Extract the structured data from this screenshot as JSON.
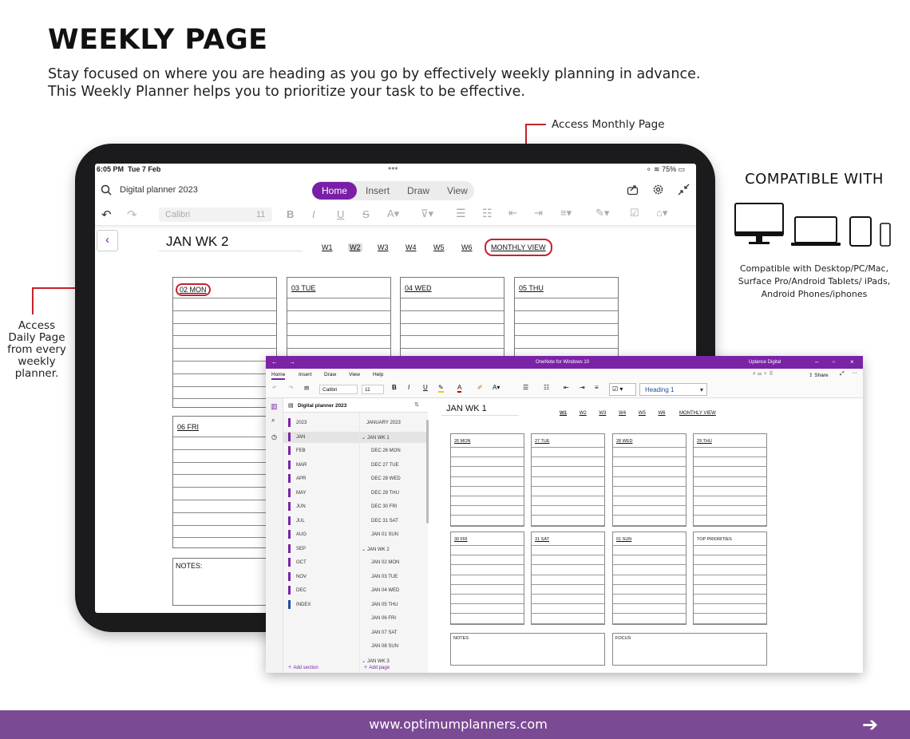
{
  "header": {
    "title": "WEEKLY PAGE",
    "subtitle_line1": "Stay focused on where you are heading as you go by effectively weekly planning in advance.",
    "subtitle_line2": "This Weekly Planner helps you to prioritize your task to be effective."
  },
  "callouts": {
    "monthly": "Access Monthly Page",
    "daily_lines": [
      "Access",
      "Daily Page",
      "from every",
      "weekly",
      "planner."
    ]
  },
  "compat": {
    "heading": "COMPATIBLE WITH",
    "text_lines": [
      "Compatible with Desktop/PC/Mac,",
      "Surface Pro/Android Tablets/ iPads,",
      "Android Phones/iphones"
    ]
  },
  "tablet": {
    "time": "6:05 PM",
    "date": "Tue 7 Feb",
    "battery": "75%",
    "search_text": "Digital planner 2023",
    "tabs": [
      "Home",
      "Insert",
      "Draw",
      "View"
    ],
    "font_name": "Calibri",
    "font_size": "11",
    "page_title": "JAN WK 2",
    "week_links": [
      "W1",
      "W2",
      "W3",
      "W4",
      "W5",
      "W6"
    ],
    "monthly_view": "MONTHLY VIEW",
    "days_top": [
      "02 MON",
      "03 TUE",
      "04 WED",
      "05 THU"
    ],
    "day_bottom": "06 FRI",
    "notes_label": "NOTES:"
  },
  "window": {
    "title": "OneNote for Windows 10",
    "account": "Uplance Digital",
    "ribbon_tabs": [
      "Home",
      "Insert",
      "Draw",
      "View",
      "Help"
    ],
    "share_label": "Share",
    "font_name": "Calibri",
    "font_size": "11",
    "style_name": "Heading 1",
    "notebook": "Digital planner 2023",
    "sections": [
      "2023",
      "JAN",
      "FEB",
      "MAR",
      "APR",
      "MAY",
      "JUN",
      "JUL",
      "AUG",
      "SEP",
      "OCT",
      "NOV",
      "DEC",
      "INDEX"
    ],
    "section_colors": [
      "#7a23a6",
      "#7a23a6",
      "#7a23a6",
      "#7a23a6",
      "#7a23a6",
      "#7a23a6",
      "#7a23a6",
      "#7a23a6",
      "#7a23a6",
      "#7a23a6",
      "#7a23a6",
      "#7a23a6",
      "#7a23a6",
      "#1f4f9e"
    ],
    "pages": [
      "JANUARY 2023",
      "JAN WK 1",
      "DEC 26 MON",
      "DEC 27 TUE",
      "DEC 28 WED",
      "DEC 29 THU",
      "DEC 30 FRI",
      "DEC 31 SAT",
      "JAN 01 SUN",
      "JAN WK 2",
      "JAN 02 MON",
      "JAN 03 TUE",
      "JAN 04 WED",
      "JAN 05 THU",
      "JAN 06 FRI",
      "JAN 07 SAT",
      "JAN 08 SUN",
      "JAN WK 3"
    ],
    "add_section": "Add section",
    "add_page": "Add page",
    "page_title": "JAN WK 1",
    "week_links": [
      "W1",
      "W2",
      "W3",
      "W4",
      "W5",
      "W6"
    ],
    "monthly_view": "MONTHLY VIEW",
    "days_top": [
      "26 MON",
      "27 TUE",
      "28 WED",
      "29 THU"
    ],
    "days_bottom": [
      "30 FRI",
      "31 SAT",
      "01 SUN",
      "TOP PRIORITIES"
    ],
    "notes_label": "NOTES",
    "focus_label": "FOCUS"
  },
  "footer": {
    "url": "www.optimumplanners.com"
  },
  "colors": {
    "accent_purple": "#7a23a6",
    "footer_purple": "#7b4a94",
    "callout_red": "#c5222e"
  }
}
